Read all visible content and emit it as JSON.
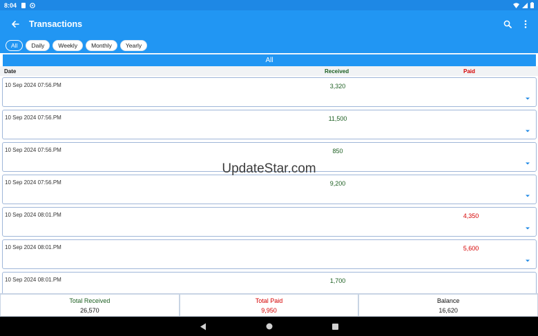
{
  "status_bar": {
    "time": "8:04"
  },
  "app_bar": {
    "title": "Transactions"
  },
  "filters": [
    {
      "label": "All",
      "active": true
    },
    {
      "label": "Daily",
      "active": false
    },
    {
      "label": "Weekly",
      "active": false
    },
    {
      "label": "Monthly",
      "active": false
    },
    {
      "label": "Yearly",
      "active": false
    }
  ],
  "section_title": "All",
  "columns": {
    "date": "Date",
    "received": "Received",
    "paid": "Paid"
  },
  "transactions": [
    {
      "date": "10 Sep 2024 07:56.PM",
      "received": "3,320",
      "paid": ""
    },
    {
      "date": "10 Sep 2024 07:56.PM",
      "received": "11,500",
      "paid": ""
    },
    {
      "date": "10 Sep 2024 07:56.PM",
      "received": "850",
      "paid": ""
    },
    {
      "date": "10 Sep 2024 07:56.PM",
      "received": "9,200",
      "paid": ""
    },
    {
      "date": "10 Sep 2024 08:01.PM",
      "received": "",
      "paid": "4,350"
    },
    {
      "date": "10 Sep 2024 08:01.PM",
      "received": "",
      "paid": "5,600"
    },
    {
      "date": "10 Sep 2024 08:01.PM",
      "received": "1,700",
      "paid": ""
    }
  ],
  "watermark": "UpdateStar.com",
  "totals": {
    "received_label": "Total Received",
    "received_value": "26,570",
    "paid_label": "Total Paid",
    "paid_value": "9,950",
    "balance_label": "Balance",
    "balance_value": "16,620"
  },
  "colors": {
    "primary": "#2196F3",
    "received": "#1B5E20",
    "paid": "#D50000",
    "row_border": "#9FB6D8"
  },
  "icons": [
    "back-arrow-icon",
    "search-icon",
    "more-vert-icon",
    "chevron-down-icon",
    "nav-back-icon",
    "nav-home-icon",
    "nav-recents-icon"
  ]
}
